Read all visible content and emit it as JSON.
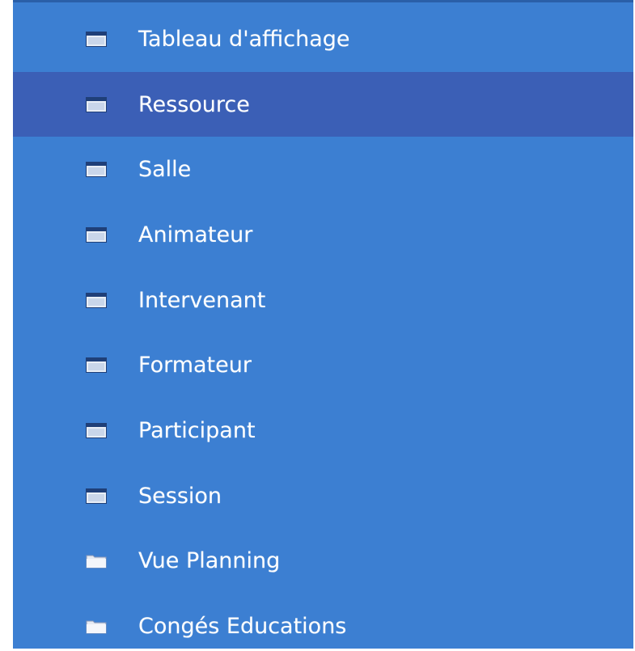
{
  "nav": {
    "items": [
      {
        "label": "Tableau d'affichage",
        "icon": "window-icon",
        "selected": false
      },
      {
        "label": "Ressource",
        "icon": "window-icon",
        "selected": true
      },
      {
        "label": "Salle",
        "icon": "window-icon",
        "selected": false
      },
      {
        "label": "Animateur",
        "icon": "window-icon",
        "selected": false
      },
      {
        "label": "Intervenant",
        "icon": "window-icon",
        "selected": false
      },
      {
        "label": "Formateur",
        "icon": "window-icon",
        "selected": false
      },
      {
        "label": "Participant",
        "icon": "window-icon",
        "selected": false
      },
      {
        "label": "Session",
        "icon": "window-icon",
        "selected": false
      },
      {
        "label": "Vue Planning",
        "icon": "folder-icon",
        "selected": false
      },
      {
        "label": "Congés Educations",
        "icon": "folder-icon",
        "selected": false
      }
    ]
  },
  "colors": {
    "panel_background": "#3c7fd2",
    "selected_background": "#3b5fb6",
    "text": "#ffffff"
  }
}
